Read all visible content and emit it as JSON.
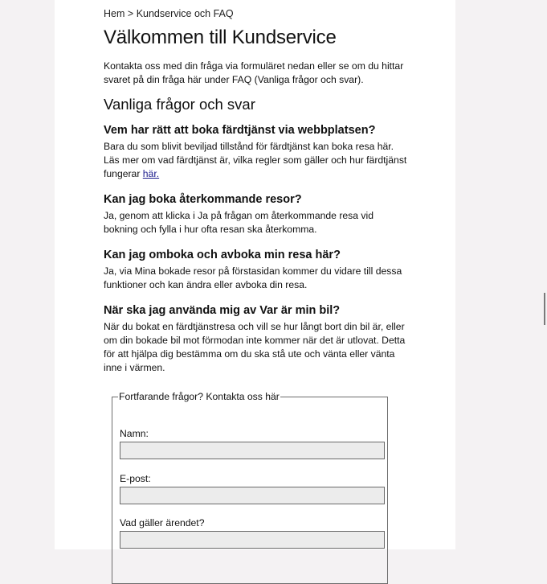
{
  "breadcrumb": {
    "home": "Hem",
    "separator": ">",
    "current": "Kundservice och FAQ"
  },
  "page": {
    "title": "Välkommen till Kundservice",
    "intro": "Kontakta oss med din fråga via formuläret nedan eller se om du hittar svaret på din fråga här under FAQ (Vanliga frågor och svar)."
  },
  "faq": {
    "heading": "Vanliga frågor och svar",
    "items": [
      {
        "question": "Vem har rätt att boka färdtjänst via webbplatsen?",
        "answer": "Bara du som blivit beviljad tillstånd för färdtjänst kan boka resa här. Läs mer om vad färdtjänst är, vilka regler som gäller och hur färdtjänst fungerar ",
        "link": "här."
      },
      {
        "question": "Kan jag boka återkommande resor?",
        "answer": "Ja, genom att klicka i Ja på frågan om återkommande resa vid bokning och fylla i hur ofta resan ska återkomma."
      },
      {
        "question": "Kan jag omboka och avboka min resa här?",
        "answer": "Ja, via Mina bokade resor på förstasidan kommer du vidare till dessa funktioner och kan ändra eller avboka din resa."
      },
      {
        "question": "När ska jag använda mig av Var är min bil?",
        "answer": "När du bokat en färdtjänstresa och vill se hur långt bort din bil är, eller om din bokade bil mot förmodan inte kommer när det är utlovat. Detta för att hjälpa dig bestämma om du ska stå ute och vänta eller vänta inne i värmen."
      }
    ]
  },
  "contact_form": {
    "legend": "Fortfarande frågor? Kontakta oss här",
    "name_label": "Namn:",
    "name_value": "",
    "email_label": "E-post:",
    "email_value": "",
    "subject_label": "Vad gäller ärendet?",
    "subject_value": ""
  }
}
